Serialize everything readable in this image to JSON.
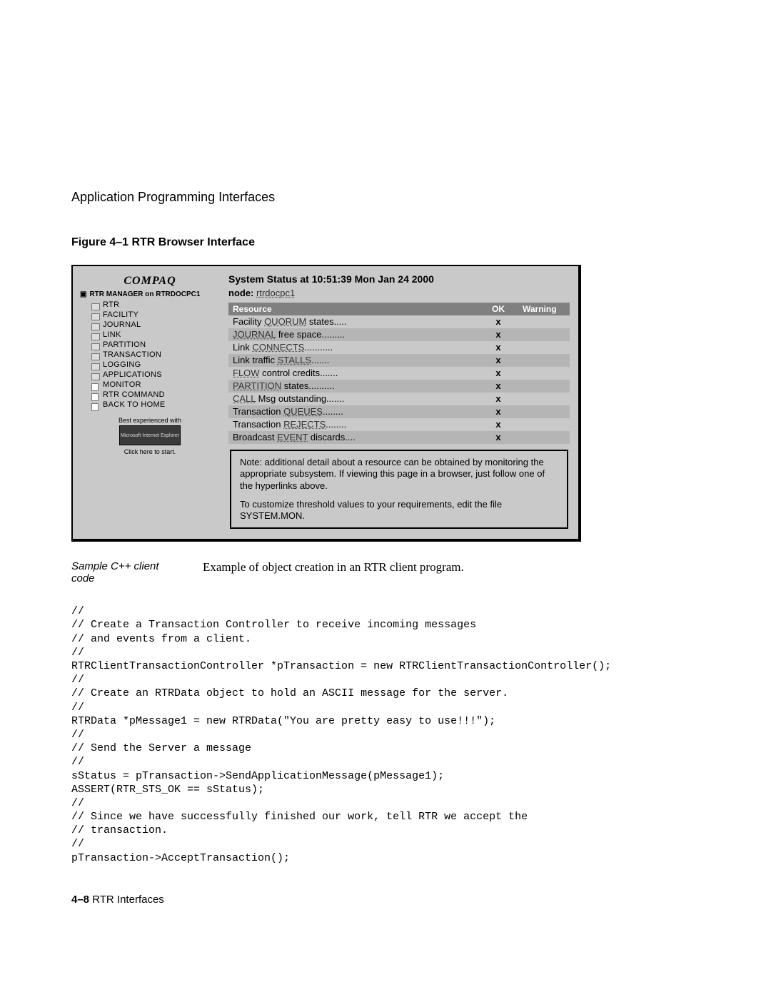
{
  "header": {
    "section": "Application Programming Interfaces"
  },
  "figure": {
    "caption": "Figure 4–1  RTR Browser Interface"
  },
  "screenshot": {
    "logo": "COMPAQ",
    "tree_root": "RTR MANAGER on RTRDOCPC1",
    "tree": [
      {
        "label": "RTR",
        "kind": "folder"
      },
      {
        "label": "FACILITY",
        "kind": "folder"
      },
      {
        "label": "JOURNAL",
        "kind": "folder"
      },
      {
        "label": "LINK",
        "kind": "folder"
      },
      {
        "label": "PARTITION",
        "kind": "folder"
      },
      {
        "label": "TRANSACTION",
        "kind": "folder"
      },
      {
        "label": "LOGGING",
        "kind": "folder"
      },
      {
        "label": "APPLICATIONS",
        "kind": "folder"
      },
      {
        "label": "MONITOR",
        "kind": "doc"
      },
      {
        "label": "RTR COMMAND",
        "kind": "doc"
      },
      {
        "label": "BACK TO HOME",
        "kind": "doc"
      }
    ],
    "tree_footer": {
      "best": "Best experienced with",
      "ie": "Microsoft Internet Explorer",
      "click": "Click here to start."
    },
    "status": "System Status at 10:51:39 Mon Jan 24 2000",
    "node_label": "node:",
    "node_value": "rtrdocpc1",
    "columns": {
      "resource": "Resource",
      "ok": "OK",
      "warning": "Warning"
    },
    "rows": [
      {
        "pre": "Facility ",
        "link": "QUORUM",
        "post": " states.....",
        "ok": "x",
        "alt": false
      },
      {
        "pre": "",
        "link": "JOURNAL",
        "post": " free space.........",
        "ok": "x",
        "alt": true
      },
      {
        "pre": "Link ",
        "link": "CONNECTS",
        "post": "...........",
        "ok": "x",
        "alt": false
      },
      {
        "pre": "Link traffic ",
        "link": "STALLS",
        "post": ".......",
        "ok": "x",
        "alt": true
      },
      {
        "pre": "",
        "link": "FLOW",
        "post": " control credits.......",
        "ok": "x",
        "alt": false
      },
      {
        "pre": "",
        "link": "PARTITION",
        "post": " states..........",
        "ok": "x",
        "alt": true
      },
      {
        "pre": "",
        "link": "CALL",
        "post": " Msg outstanding.......",
        "ok": "x",
        "alt": false
      },
      {
        "pre": "Transaction ",
        "link": "QUEUES",
        "post": "........",
        "ok": "x",
        "alt": true
      },
      {
        "pre": "Transaction ",
        "link": "REJECTS",
        "post": "........",
        "ok": "x",
        "alt": false
      },
      {
        "pre": "Broadcast ",
        "link": "EVENT",
        "post": " discards....",
        "ok": "x",
        "alt": true
      }
    ],
    "note": {
      "p1": "Note: additional detail about a resource can be obtained by monitoring the appropriate subsystem. If viewing this page in a browser, just follow one of the hyperlinks above.",
      "p2": "To customize threshold values to your requirements, edit the file SYSTEM.MON."
    }
  },
  "sample": {
    "label": "Sample C++ client code",
    "text": "Example of object creation in an RTR client program."
  },
  "code": "//\n// Create a Transaction Controller to receive incoming messages\n// and events from a client.\n//\nRTRClientTransactionController *pTransaction = new RTRClientTransactionController();\n//\n// Create an RTRData object to hold an ASCII message for the server.\n//\nRTRData *pMessage1 = new RTRData(\"You are pretty easy to use!!!\");\n//\n// Send the Server a message\n//\nsStatus = pTransaction->SendApplicationMessage(pMessage1);\nASSERT(RTR_STS_OK == sStatus);\n//\n// Since we have successfully finished our work, tell RTR we accept the\n// transaction.\n//\npTransaction->AcceptTransaction();",
  "footer": {
    "pageno": "4–8",
    "title": "RTR Interfaces"
  }
}
